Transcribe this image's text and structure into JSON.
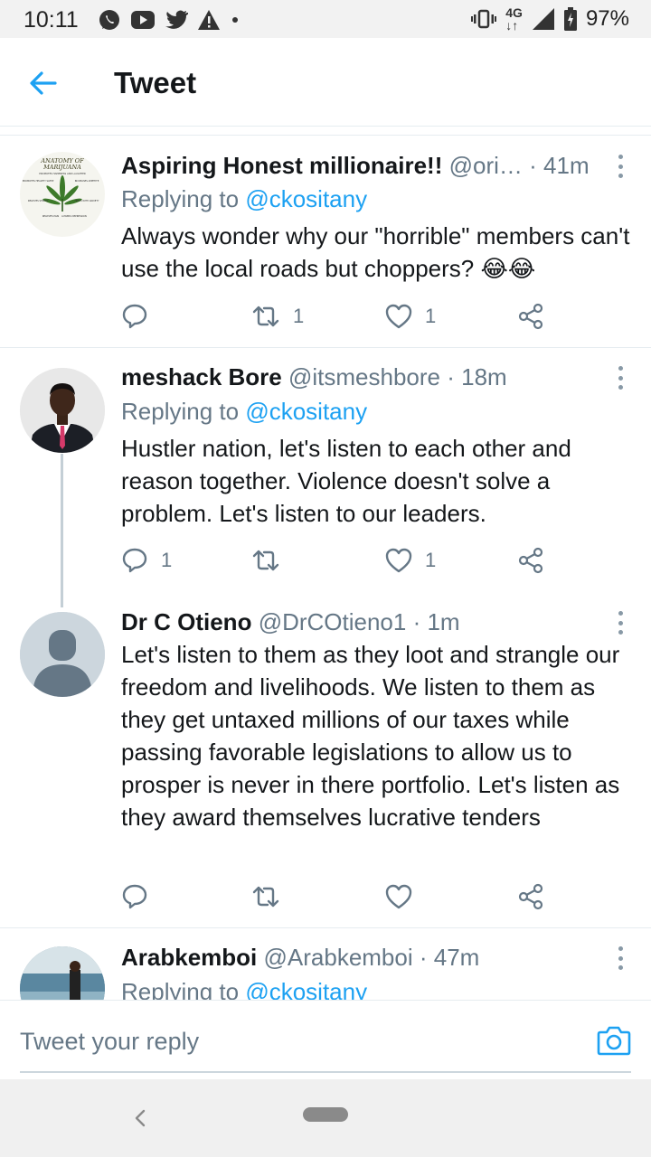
{
  "status_bar": {
    "time": "10:11",
    "network": "4G",
    "battery": "97%",
    "left_icons": [
      "whatsapp-icon",
      "youtube-icon",
      "twitter-icon",
      "warning-icon",
      "dot-icon"
    ],
    "right_icons": [
      "vibrate-icon",
      "signal-icon",
      "battery-icon"
    ]
  },
  "header": {
    "title": "Tweet",
    "back_icon": "back-arrow-icon"
  },
  "colors": {
    "accent": "#1da1f2",
    "text": "#14171a",
    "muted": "#657786",
    "divider": "#e6ecf0"
  },
  "tweets": [
    {
      "name": "Aspiring Honest millionaire!!",
      "handle": "@ori…",
      "time": "· 41m",
      "replying_prefix": "Replying to",
      "replying_handle": "@ckositany",
      "body": "Always wonder why our \"horrible\" members can't use the local roads but choppers? 😂😂",
      "replies": "",
      "retweets": "1",
      "likes": "1",
      "avatar_text": [
        "ANATOMY OF",
        "MARIJUANA",
        "PROMOTES HAPPINESS AND LAUGHTER",
        "PROMOTES HEALTHY SLEEP",
        "INCREASES APPETITE",
        "RELIEVES STRESS",
        "HELPS WITH ANXIETY",
        "RELIEVES PAIN",
        "LOWERS DEPRESSION"
      ]
    },
    {
      "name": "meshack Bore",
      "handle": "@itsmeshbore",
      "time": "· 18m",
      "replying_prefix": "Replying to",
      "replying_handle": "@ckositany",
      "body": "Hustler nation, let's listen to each other and reason together. Violence doesn't solve a problem. Let's listen to our leaders.",
      "replies": "1",
      "retweets": "",
      "likes": "1"
    },
    {
      "name": "Dr C Otieno",
      "handle": "@DrCOtieno1",
      "time": "· 1m",
      "body": "Let's listen to them as they loot and strangle our freedom and livelihoods. We listen to them as they get untaxed millions of our taxes while passing favorable legislations to allow us to prosper is never in there portfolio. Let's listen as they award themselves lucrative tenders",
      "replies": "",
      "retweets": "",
      "likes": ""
    },
    {
      "name": "Arabkemboi",
      "handle": "@Arabkemboi",
      "time": "· 47m",
      "replying_prefix": "Replying to",
      "replying_handle": "@ckositany"
    }
  ],
  "reply_bar": {
    "placeholder": "Tweet your reply",
    "camera_icon": "camera-icon"
  },
  "nav_bar": {
    "back_icon": "nav-back-icon",
    "home_icon": "nav-home-pill"
  }
}
